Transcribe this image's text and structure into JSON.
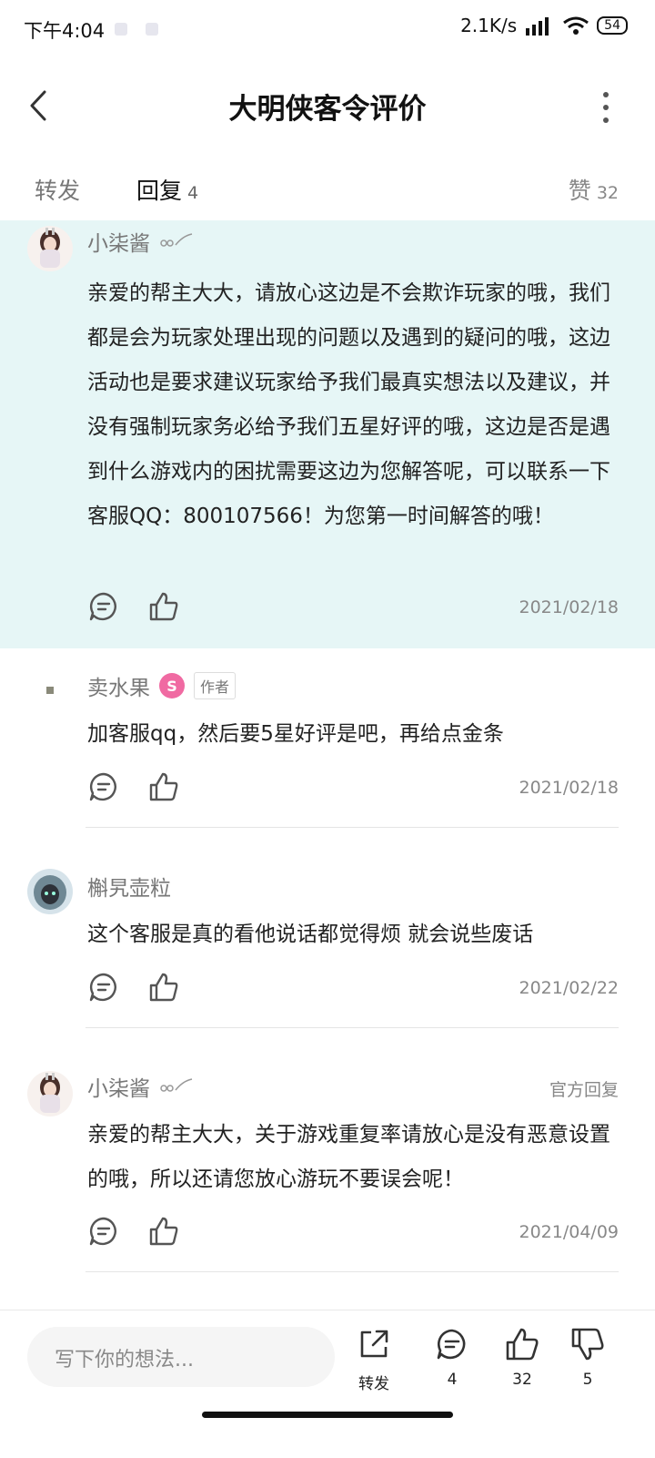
{
  "status_bar": {
    "time": "下午4:04",
    "network_speed": "2.1K/s",
    "battery": "54"
  },
  "header": {
    "title": "大明侠客令评价"
  },
  "tabs": {
    "forward": {
      "label": "转发"
    },
    "replies": {
      "label": "回复",
      "count": "4"
    },
    "likes": {
      "label": "赞",
      "count": "32"
    }
  },
  "comments": [
    {
      "name": "小柒酱",
      "body": "亲爱的帮主大大，请放心这边是不会欺诈玩家的哦，我们都是会为玩家处理出现的问题以及遇到的疑问的哦，这边活动也是要求建议玩家给予我们最真实想法以及建议，并没有强制玩家务必给予我们五星好评的哦，这边是否是遇到什么游戏内的困扰需要这边为您解答呢，可以联系一下客服QQ：800107566！为您第一时间解答的哦！",
      "date": "2021/02/18"
    },
    {
      "name": "卖水果",
      "author_tag": "作者",
      "badge": "S",
      "body": "加客服qq，然后要5星好评是吧，再给点金条",
      "date": "2021/02/18"
    },
    {
      "name": "槲旯壶粒",
      "body": "这个客服是真的看他说话都觉得烦 就会说些废话",
      "date": "2021/02/22"
    },
    {
      "name": "小柒酱",
      "official_label": "官方回复",
      "body": "亲爱的帮主大大，关于游戏重复率请放心是没有恶意设置的哦，所以还请您放心游玩不要误会呢！",
      "date": "2021/04/09"
    }
  ],
  "bottom_bar": {
    "input_placeholder": "写下你的想法...",
    "forward_label": "转发",
    "comment_count": "4",
    "like_count": "32",
    "dislike_count": "5"
  },
  "colors": {
    "accent": "#16b6b8",
    "highlight_bg": "#e6f6f6",
    "badge": "#f06aa2"
  }
}
